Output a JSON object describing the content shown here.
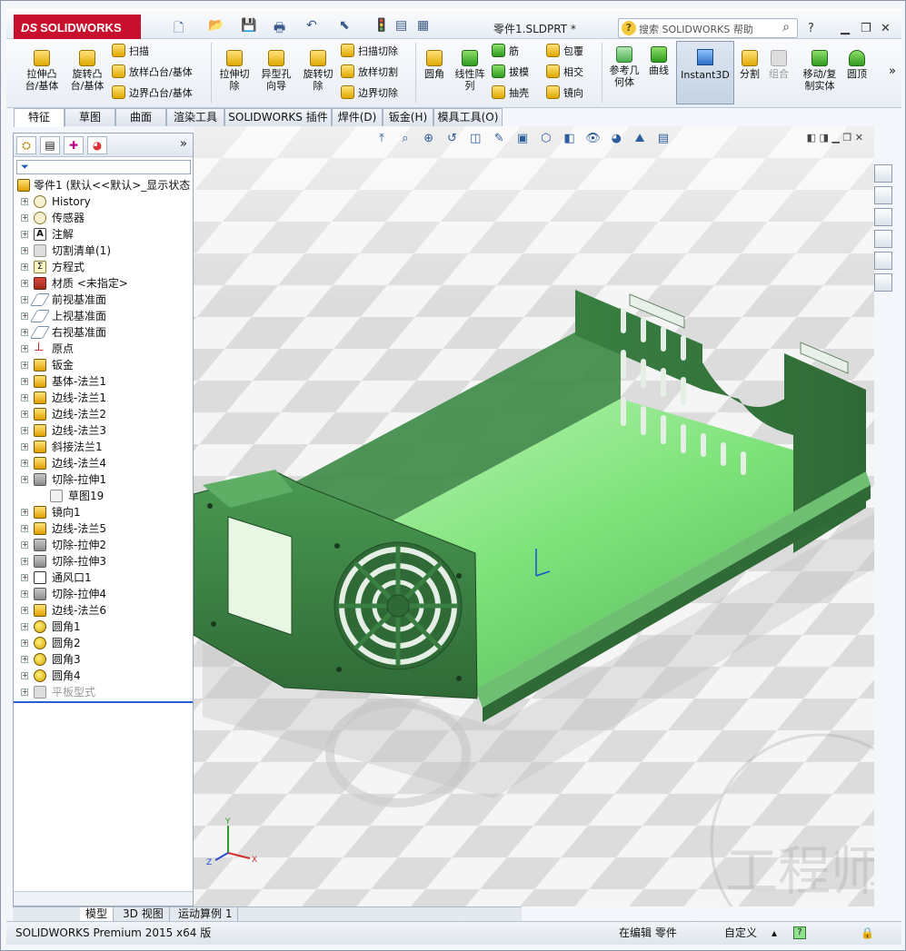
{
  "app": {
    "brand": "SOLIDWORKS",
    "brand_mark": "DS",
    "window_title": "零件1.SLDPRT *",
    "search_placeholder": "搜索 SOLIDWORKS 帮助"
  },
  "ribbon": {
    "extrude_boss": "拉伸凸台/基体",
    "revolve_boss": "旋转凸台/基体",
    "sweep": "扫描",
    "loft_boss": "放样凸台/基体",
    "boundary_boss": "边界凸台/基体",
    "extrude_cut": "拉伸切除",
    "hole_wizard": "异型孔向导",
    "revolve_cut": "旋转切除",
    "swept_cut": "扫描切除",
    "lofted_cut": "放样切割",
    "boundary_cut": "边界切除",
    "fillet": "圆角",
    "linear_pattern": "线性阵列",
    "rib": "筋",
    "draft": "拔模",
    "shell": "抽壳",
    "wrap": "包覆",
    "intersect": "相交",
    "mirror": "镜向",
    "ref_geometry": "参考几何体",
    "curves": "曲线",
    "instant3d": "Instant3D",
    "split": "分割",
    "combine": "组合",
    "move_copy": "移动/复制实体",
    "dome": "圆顶"
  },
  "tabs": [
    "特征",
    "草图",
    "曲面",
    "渲染工具",
    "SOLIDWORKS 插件",
    "焊件(D)",
    "钣金(H)",
    "模具工具(O)"
  ],
  "feature_tree": {
    "root": "零件1 (默认<<默认>_显示状态",
    "items": [
      {
        "label": "History",
        "icon": "hist"
      },
      {
        "label": "传感器",
        "icon": "hist"
      },
      {
        "label": "注解",
        "icon": "note"
      },
      {
        "label": "切割清单(1)",
        "icon": "dim"
      },
      {
        "label": "方程式",
        "icon": "eq"
      },
      {
        "label": "材质 <未指定>",
        "icon": "mat"
      },
      {
        "label": "前视基准面",
        "icon": "plane"
      },
      {
        "label": "上视基准面",
        "icon": "plane"
      },
      {
        "label": "右视基准面",
        "icon": "plane"
      },
      {
        "label": "原点",
        "icon": "origin"
      },
      {
        "label": "钣金",
        "icon": "feat"
      },
      {
        "label": "基体-法兰1",
        "icon": "feat"
      },
      {
        "label": "边线-法兰1",
        "icon": "feat"
      },
      {
        "label": "边线-法兰2",
        "icon": "feat"
      },
      {
        "label": "边线-法兰3",
        "icon": "feat"
      },
      {
        "label": "斜接法兰1",
        "icon": "feat"
      },
      {
        "label": "边线-法兰4",
        "icon": "feat"
      },
      {
        "label": "切除-拉伸1",
        "icon": "cut"
      },
      {
        "label": "草图19",
        "icon": "sk"
      },
      {
        "label": "镜向1",
        "icon": "feat"
      },
      {
        "label": "边线-法兰5",
        "icon": "feat"
      },
      {
        "label": "切除-拉伸2",
        "icon": "cut"
      },
      {
        "label": "切除-拉伸3",
        "icon": "cut"
      },
      {
        "label": "通风口1",
        "icon": "vent"
      },
      {
        "label": "切除-拉伸4",
        "icon": "cut"
      },
      {
        "label": "边线-法兰6",
        "icon": "feat"
      },
      {
        "label": "圆角1",
        "icon": "fil"
      },
      {
        "label": "圆角2",
        "icon": "fil"
      },
      {
        "label": "圆角3",
        "icon": "fil"
      },
      {
        "label": "圆角4",
        "icon": "fil"
      },
      {
        "label": "平板型式",
        "icon": "dim"
      }
    ]
  },
  "bottom_tabs": [
    "模型",
    "3D 视图",
    "运动算例 1"
  ],
  "status": {
    "product": "SOLIDWORKS Premium 2015 x64 版",
    "editing": "在编辑 零件",
    "units": "自定义"
  },
  "triad": {
    "y": "Y",
    "z": "Z",
    "x": "X"
  },
  "watermark": "工程师",
  "colors": {
    "brand": "#c8102e",
    "model_green": "#3e8f46",
    "model_light": "#7ee37a"
  }
}
